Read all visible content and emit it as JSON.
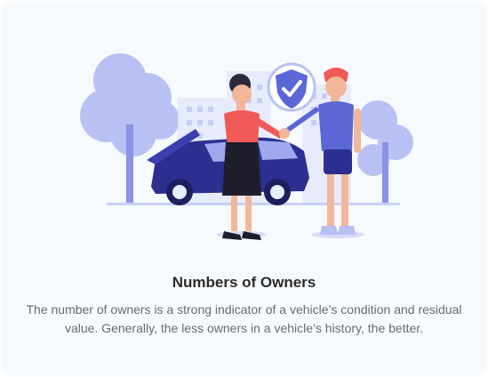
{
  "card": {
    "title": "Numbers of Owners",
    "description": "The number of owners is a strong indicator of a vehicle’s condition and residual value. Generally, the less owners in a vehicle’s history, the better."
  },
  "colors": {
    "accent_blue": "#5b67d6",
    "car_blue": "#2c2f8f",
    "light_blue": "#b7bff3",
    "shirt_red": "#ef5a57",
    "text_dark": "#2b2b2b",
    "text_gray": "#6b6b6b"
  },
  "icons": [
    "shield-check-icon"
  ]
}
